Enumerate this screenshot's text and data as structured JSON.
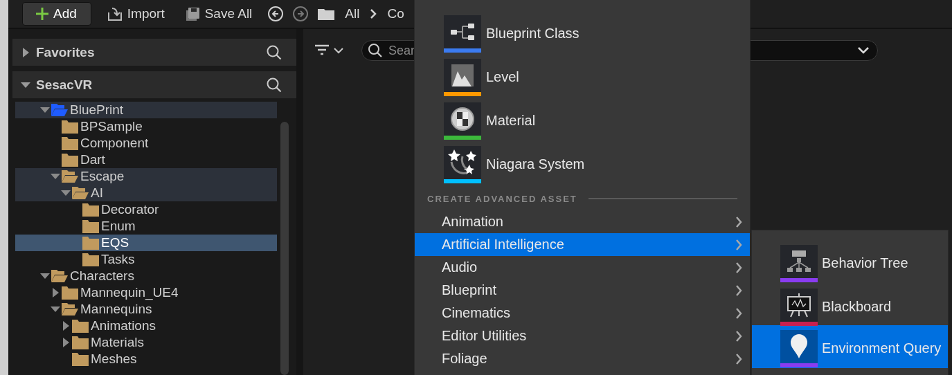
{
  "toolbar": {
    "buttons": [
      {
        "kind": "add",
        "label": "Add"
      },
      {
        "kind": "import",
        "label": "Import"
      },
      {
        "kind": "save",
        "label": "Save All"
      }
    ],
    "history": [
      {
        "kind": "back",
        "disabled": false
      },
      {
        "kind": "forward",
        "disabled": true
      }
    ],
    "breadcrumb": [
      "All",
      "Co"
    ]
  },
  "sources_panel": {
    "sections": [
      {
        "title": "Favorites",
        "expanded": false
      },
      {
        "title": "SesacVR",
        "expanded": true
      }
    ],
    "tree": [
      {
        "label": "BluePrint",
        "kind": "branch",
        "expanded": true,
        "in_path": true,
        "selected": false,
        "color": "#1f5cff",
        "children": [
          {
            "label": "BPSample",
            "kind": "leaf",
            "expanded": false,
            "in_path": false,
            "selected": false,
            "color": "#c09a5e"
          },
          {
            "label": "Component",
            "kind": "leaf",
            "expanded": false,
            "in_path": false,
            "selected": false,
            "color": "#c09a5e"
          },
          {
            "label": "Dart",
            "kind": "leaf",
            "expanded": false,
            "in_path": false,
            "selected": false,
            "color": "#c09a5e"
          },
          {
            "label": "Escape",
            "kind": "branch",
            "expanded": true,
            "in_path": true,
            "selected": false,
            "color": "#c09a5e",
            "children": [
              {
                "label": "AI",
                "kind": "branch",
                "expanded": true,
                "in_path": true,
                "selected": false,
                "color": "#c09a5e",
                "children": [
                  {
                    "label": "Decorator",
                    "kind": "leaf",
                    "expanded": false,
                    "in_path": false,
                    "selected": false,
                    "color": "#c09a5e"
                  },
                  {
                    "label": "Enum",
                    "kind": "leaf",
                    "expanded": false,
                    "in_path": false,
                    "selected": false,
                    "color": "#c09a5e"
                  },
                  {
                    "label": "EQS",
                    "kind": "leaf",
                    "expanded": false,
                    "in_path": false,
                    "selected": true,
                    "color": "#c09a5e"
                  },
                  {
                    "label": "Tasks",
                    "kind": "leaf",
                    "expanded": false,
                    "in_path": false,
                    "selected": false,
                    "color": "#c09a5e"
                  }
                ]
              }
            ]
          }
        ]
      },
      {
        "label": "Characters",
        "kind": "branch",
        "expanded": true,
        "in_path": false,
        "selected": false,
        "color": "#c09a5e",
        "children": [
          {
            "label": "Mannequin_UE4",
            "kind": "branch",
            "expanded": false,
            "in_path": false,
            "selected": false,
            "color": "#c09a5e"
          },
          {
            "label": "Mannequins",
            "kind": "branch",
            "expanded": true,
            "in_path": false,
            "selected": false,
            "color": "#c09a5e",
            "children": [
              {
                "label": "Animations",
                "kind": "branch",
                "expanded": false,
                "in_path": false,
                "selected": false,
                "color": "#c09a5e"
              },
              {
                "label": "Materials",
                "kind": "branch",
                "expanded": false,
                "in_path": false,
                "selected": false,
                "color": "#c09a5e"
              },
              {
                "label": "Meshes",
                "kind": "leaf",
                "expanded": false,
                "in_path": false,
                "selected": false,
                "color": "#c09a5e"
              }
            ]
          }
        ]
      }
    ]
  },
  "content_area": {
    "search": {
      "placeholder": "Sear"
    }
  },
  "add_menu": {
    "basic_assets": [
      {
        "label": "Blueprint Class",
        "kind": "blueprint",
        "color": "#3b7bf0"
      },
      {
        "label": "Level",
        "kind": "level",
        "color": "#ff9800"
      },
      {
        "label": "Material",
        "kind": "material",
        "color": "#3cb83c"
      },
      {
        "label": "Niagara System",
        "kind": "niagara",
        "color": "#00c0ff"
      }
    ],
    "advanced_heading": "CREATE ADVANCED ASSET",
    "categories": [
      {
        "label": "Animation",
        "selected": false
      },
      {
        "label": "Artificial Intelligence",
        "selected": true
      },
      {
        "label": "Audio",
        "selected": false
      },
      {
        "label": "Blueprint",
        "selected": false
      },
      {
        "label": "Cinematics",
        "selected": false
      },
      {
        "label": "Editor Utilities",
        "selected": false
      },
      {
        "label": "Foliage",
        "selected": false
      }
    ],
    "submenu": [
      {
        "label": "Behavior Tree",
        "kind": "behavior_tree",
        "color": "#8a3cf0",
        "selected": false
      },
      {
        "label": "Blackboard",
        "kind": "blackboard",
        "color": "#c8204f",
        "selected": false
      },
      {
        "label": "Environment Query",
        "kind": "env_query",
        "color": "#8a3cf0",
        "selected": true
      }
    ]
  }
}
